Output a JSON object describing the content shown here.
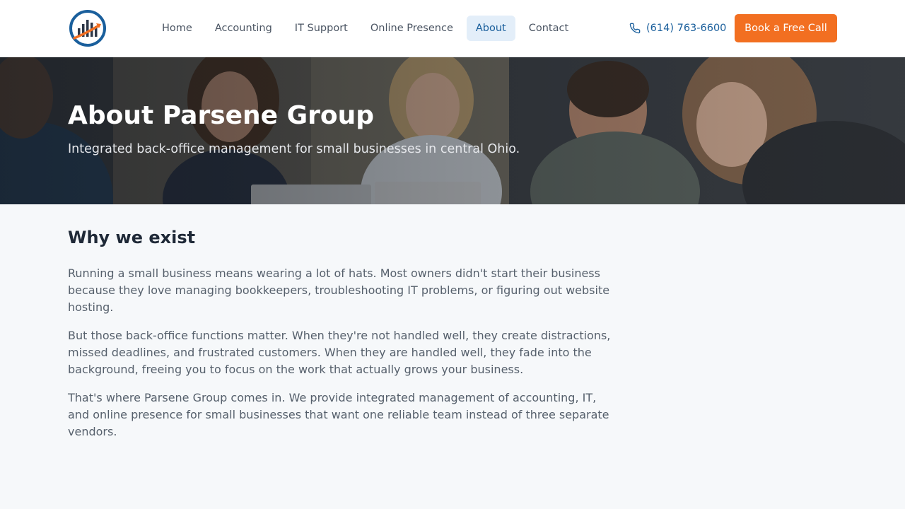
{
  "header": {
    "logo_icon": "bar-chart-growth-logo",
    "nav": [
      {
        "label": "Home"
      },
      {
        "label": "Accounting"
      },
      {
        "label": "IT Support"
      },
      {
        "label": "Online Presence"
      },
      {
        "label": "About"
      },
      {
        "label": "Contact"
      }
    ],
    "active_nav": "About",
    "phone": "(614) 763-6600",
    "phone_icon": "phone-icon",
    "cta_label": "Book a Free Call"
  },
  "hero": {
    "title": "About Parsene Group",
    "subtitle": "Integrated back-office management for small businesses in central Ohio."
  },
  "main": {
    "section_title": "Why we exist",
    "paragraphs": [
      "Running a small business means wearing a lot of hats. Most owners didn't start their business because they love managing bookkeepers, troubleshooting IT problems, or figuring out website hosting.",
      "But those back-office functions matter. When they're not handled well, they create distractions, missed deadlines, and frustrated customers. When they are handled well, they fade into the background, freeing you to focus on the work that actually grows your business.",
      "That's where Parsene Group comes in. We provide integrated management of accounting, IT, and online presence for small businesses that want one reliable team instead of three separate vendors."
    ]
  },
  "colors": {
    "brand_blue": "#1a5f9c",
    "accent_orange": "#f26f21",
    "active_nav_bg": "#e3eef9",
    "page_bg": "#f6f8fa"
  }
}
